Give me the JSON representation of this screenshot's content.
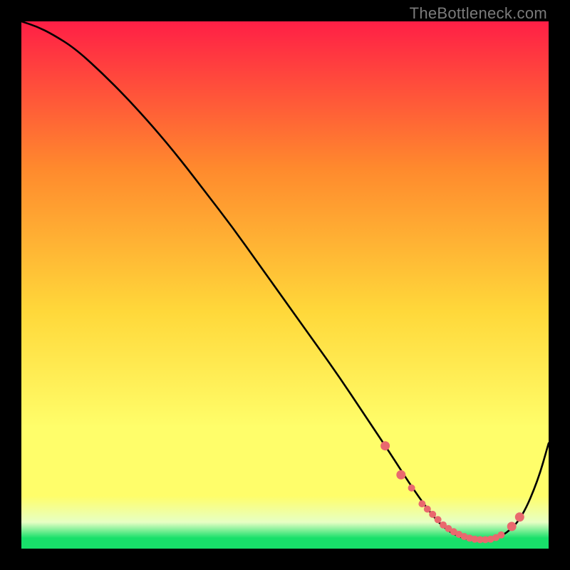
{
  "watermark": "TheBottleneck.com",
  "colors": {
    "top": "#ff1f46",
    "mid1": "#ff8a2d",
    "mid2": "#ffd83a",
    "mid3": "#fffe6a",
    "pale": "#e7ffc4",
    "green": "#18e06a",
    "curve": "#000000",
    "dot": "#e9696e"
  },
  "chart_data": {
    "type": "line",
    "title": "",
    "xlabel": "",
    "ylabel": "",
    "xlim": [
      0,
      100
    ],
    "ylim": [
      0,
      100
    ],
    "series": [
      {
        "name": "bottleneck-curve",
        "x": [
          0,
          3,
          6,
          10,
          15,
          20,
          25,
          30,
          35,
          40,
          45,
          50,
          55,
          60,
          65,
          70,
          73.5,
          77,
          80,
          83,
          86,
          89,
          92,
          95,
          98,
          100
        ],
        "values": [
          100,
          99,
          97.5,
          95,
          90.5,
          85.5,
          80,
          74,
          67.5,
          61,
          54,
          47,
          40,
          33,
          25.5,
          18,
          12.5,
          7.5,
          4,
          2.2,
          1.5,
          1.6,
          2.8,
          6,
          13,
          20
        ]
      }
    ],
    "highlight_points": {
      "name": "sweet-spot-dots",
      "x": [
        69,
        72,
        74,
        76,
        77,
        78,
        79,
        80,
        81,
        82,
        83,
        84,
        85,
        86,
        87,
        88,
        89,
        90,
        91,
        93,
        94.5
      ],
      "values": [
        19.5,
        14,
        11.5,
        8.5,
        7.5,
        6.5,
        5.5,
        4.5,
        3.8,
        3.2,
        2.7,
        2.3,
        2.0,
        1.8,
        1.7,
        1.7,
        1.8,
        2.1,
        2.6,
        4.2,
        6.0
      ]
    }
  }
}
